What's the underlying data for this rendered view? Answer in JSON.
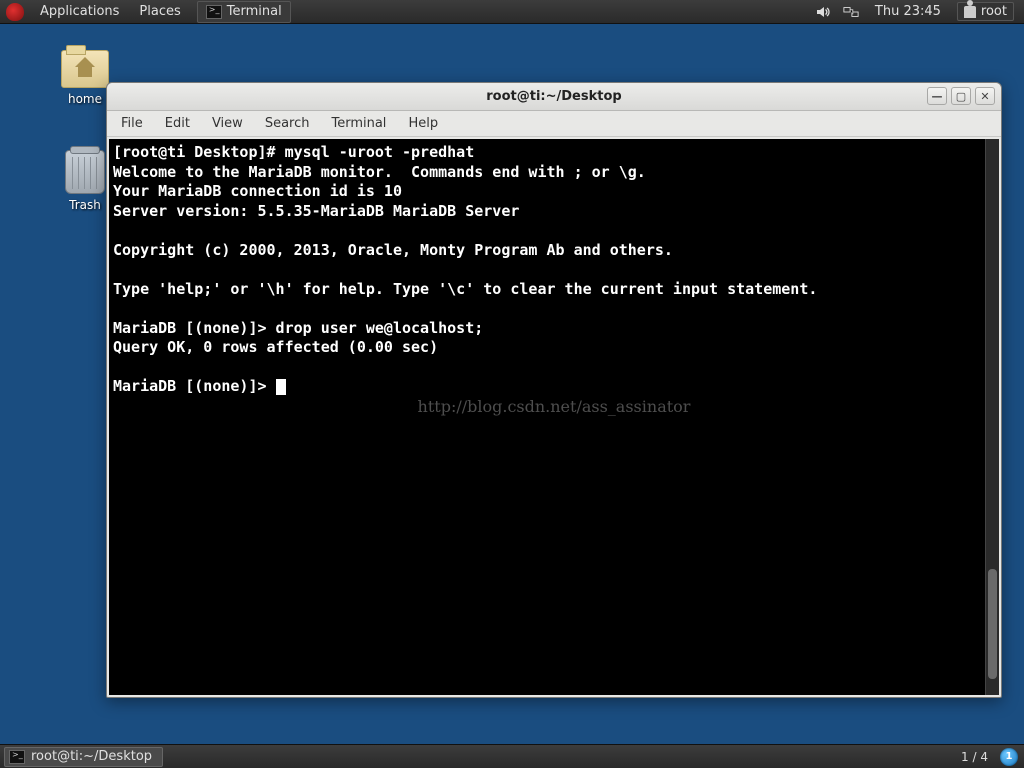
{
  "top_panel": {
    "applications": "Applications",
    "places": "Places",
    "running_task": "Terminal",
    "clock": "Thu 23:45",
    "user": "root"
  },
  "desktop": {
    "home_label": "home",
    "trash_label": "Trash"
  },
  "window": {
    "title": "root@ti:~/Desktop",
    "menu": {
      "file": "File",
      "edit": "Edit",
      "view": "View",
      "search": "Search",
      "terminal": "Terminal",
      "help": "Help"
    }
  },
  "terminal": {
    "lines": [
      "[root@ti Desktop]# mysql -uroot -predhat",
      "Welcome to the MariaDB monitor.  Commands end with ; or \\g.",
      "Your MariaDB connection id is 10",
      "Server version: 5.5.35-MariaDB MariaDB Server",
      "",
      "Copyright (c) 2000, 2013, Oracle, Monty Program Ab and others.",
      "",
      "Type 'help;' or '\\h' for help. Type '\\c' to clear the current input statement.",
      "",
      "MariaDB [(none)]> drop user we@localhost;",
      "Query OK, 0 rows affected (0.00 sec)",
      "",
      "MariaDB [(none)]> "
    ],
    "watermark": "http://blog.csdn.net/ass_assinator"
  },
  "bottom_panel": {
    "task": "root@ti:~/Desktop",
    "workspace": "1 / 4",
    "indicator": "1"
  }
}
